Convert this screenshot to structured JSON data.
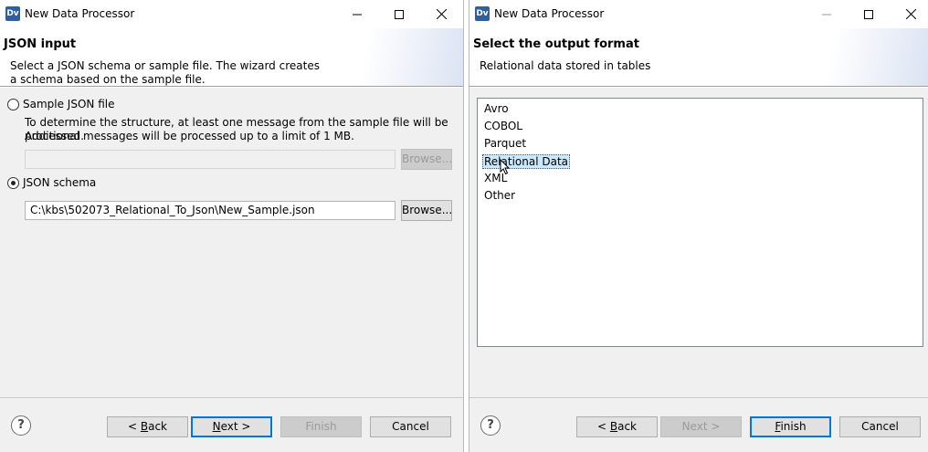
{
  "left": {
    "window_title": "New Data Processor",
    "app_icon": "Dv",
    "header_title": "JSON input",
    "header_desc": "Select a JSON schema or sample file. The wizard creates a schema based on the sample file.",
    "option_sample_label": "Sample JSON file",
    "sample_note_line1": "To determine the structure, at least one message from the sample file will be processed.",
    "sample_note_line2": "Additional messages will be processed up to a limit of 1 MB.",
    "sample_path": "",
    "sample_browse": "Browse...",
    "option_schema_label": "JSON schema",
    "schema_path": "C:\\kbs\\502073_Relational_To_Json\\New_Sample.json",
    "schema_browse": "Browse...",
    "selected_option": "JSON schema",
    "buttons": {
      "back_prefix": "< ",
      "back_ul": "B",
      "back_rest": "ack",
      "next_ul": "N",
      "next_rest": "ext >",
      "finish": "Finish",
      "cancel": "Cancel"
    }
  },
  "right": {
    "window_title": "New Data Processor",
    "app_icon": "Dv",
    "header_title": "Select the output format",
    "header_desc": "Relational data stored in tables",
    "formats": [
      "Avro",
      "COBOL",
      "Parquet",
      "Relational Data",
      "XML",
      "Other"
    ],
    "selected_format": "Relational Data",
    "buttons": {
      "back_prefix": "< ",
      "back_ul": "B",
      "back_rest": "ack",
      "next": "Next >",
      "finish_ul": "F",
      "finish_rest": "inish",
      "cancel": "Cancel"
    }
  },
  "icons": {
    "help": "help-icon",
    "minimize": "minimize-icon",
    "maximize": "maximize-icon",
    "close": "close-icon",
    "cursor": "mouse-cursor-icon"
  },
  "colors": {
    "default_button_border": "#0078d7",
    "selection_background": "#cce8ff",
    "dialog_background": "#f0f0f0"
  }
}
